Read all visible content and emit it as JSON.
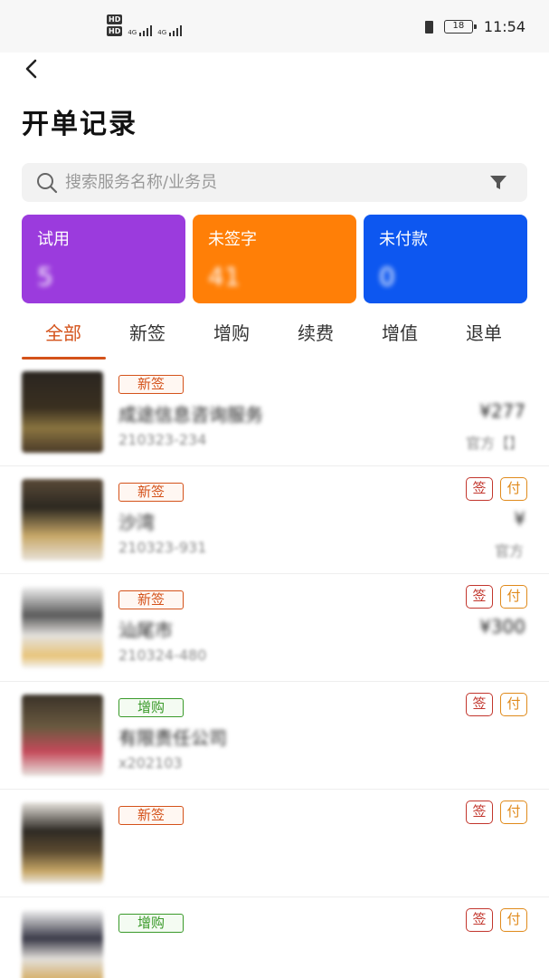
{
  "status_bar": {
    "hd1": "HD",
    "hd2": "HD",
    "net1": "4G",
    "net2": "4G",
    "battery": "18",
    "time": "11:54"
  },
  "header": {
    "title": "开单记录"
  },
  "search": {
    "placeholder": "搜索服务名称/业务员"
  },
  "summary_cards": [
    {
      "label": "试用",
      "count": "5",
      "color": "#9b3bdd"
    },
    {
      "label": "未签字",
      "count": "41",
      "color": "#ff7f07"
    },
    {
      "label": "未付款",
      "count": "0",
      "color": "#0d57f0"
    }
  ],
  "tabs": [
    "全部",
    "新签",
    "增购",
    "续费",
    "增值",
    "退单"
  ],
  "active_tab": "全部",
  "records": [
    {
      "tag": "新签",
      "name": "成途信息咨询服务",
      "amount": "¥277",
      "order": "210323-234",
      "source": "官方【】",
      "sign": "",
      "pay": ""
    },
    {
      "tag": "新签",
      "name": "沙湾",
      "amount": "¥",
      "order": "210323-931",
      "source": "官方",
      "sign": "签",
      "pay": "付"
    },
    {
      "tag": "新签",
      "name": "汕尾市",
      "amount": "¥300",
      "order": "210324-480",
      "source": "",
      "sign": "签",
      "pay": "付"
    },
    {
      "tag": "增购",
      "name": "有限责任公司",
      "amount": "",
      "order": "x202103",
      "source": "",
      "sign": "签",
      "pay": "付"
    },
    {
      "tag": "新签",
      "name": "",
      "amount": "",
      "order": "",
      "source": "",
      "sign": "签",
      "pay": "付"
    },
    {
      "tag": "增购",
      "name": "",
      "amount": "",
      "order": "",
      "source": "",
      "sign": "签",
      "pay": "付"
    }
  ],
  "colors": {
    "accent": "#d4521a",
    "new_tag": "#d4521a",
    "upgrade_tag": "#3a9a2a",
    "sign_pill": "#c2362d",
    "pay_pill": "#e08a1b"
  }
}
